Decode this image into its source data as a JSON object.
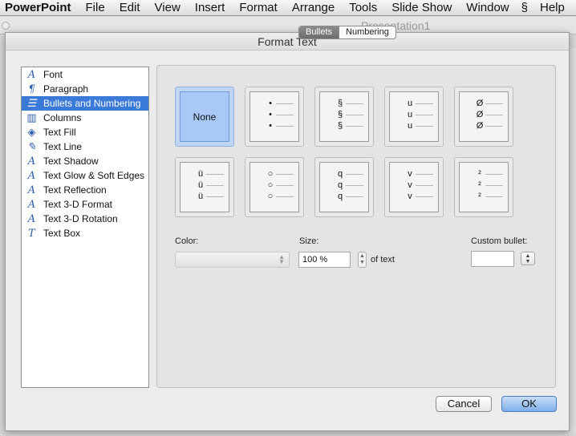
{
  "menubar": {
    "app": "PowerPoint",
    "items": [
      "File",
      "Edit",
      "View",
      "Insert",
      "Format",
      "Arrange",
      "Tools",
      "Slide Show",
      "Window"
    ],
    "help": "Help"
  },
  "background": {
    "window_title": "Presentation1"
  },
  "dialog": {
    "title": "Format Text",
    "sidebar": [
      {
        "label": "Font",
        "icon": "font-icon",
        "glyph": "A"
      },
      {
        "label": "Paragraph",
        "icon": "paragraph-icon",
        "glyph": "¶"
      },
      {
        "label": "Bullets and Numbering",
        "icon": "bullets-icon",
        "glyph": "☰"
      },
      {
        "label": "Columns",
        "icon": "columns-icon",
        "glyph": "▥"
      },
      {
        "label": "Text Fill",
        "icon": "paint-bucket-icon",
        "glyph": "◈"
      },
      {
        "label": "Text Line",
        "icon": "pencil-icon",
        "glyph": "✎"
      },
      {
        "label": "Text Shadow",
        "icon": "text-shadow-icon",
        "glyph": "A"
      },
      {
        "label": "Text Glow & Soft Edges",
        "icon": "text-glow-icon",
        "glyph": "A"
      },
      {
        "label": "Text Reflection",
        "icon": "text-reflection-icon",
        "glyph": "A"
      },
      {
        "label": "Text 3-D Format",
        "icon": "text-3d-format-icon",
        "glyph": "A"
      },
      {
        "label": "Text 3-D Rotation",
        "icon": "text-3d-rotation-icon",
        "glyph": "A"
      },
      {
        "label": "Text Box",
        "icon": "text-box-icon",
        "glyph": "T"
      }
    ],
    "selected_item": "Bullets and Numbering",
    "tabs": [
      {
        "label": "Bullets",
        "active": true
      },
      {
        "label": "Numbering",
        "active": false
      }
    ],
    "bullet_styles": [
      {
        "label": "None",
        "selected": true
      },
      {
        "glyph": "•"
      },
      {
        "glyph": "§"
      },
      {
        "glyph": "u"
      },
      {
        "glyph": "Ø"
      },
      {
        "glyph": "ü"
      },
      {
        "glyph": "○"
      },
      {
        "glyph": "q"
      },
      {
        "glyph": "v"
      },
      {
        "glyph": "²"
      }
    ],
    "color_label": "Color:",
    "size_label": "Size:",
    "size_value": "100 %",
    "size_suffix": "of text",
    "custom_bullet_label": "Custom bullet:",
    "custom_bullet_value": "",
    "cancel_label": "Cancel",
    "ok_label": "OK"
  },
  "colors": {
    "selection": "#3b7ad8",
    "selected_tile": "#a9c8f5",
    "ok_button": "#7fb0ea"
  }
}
